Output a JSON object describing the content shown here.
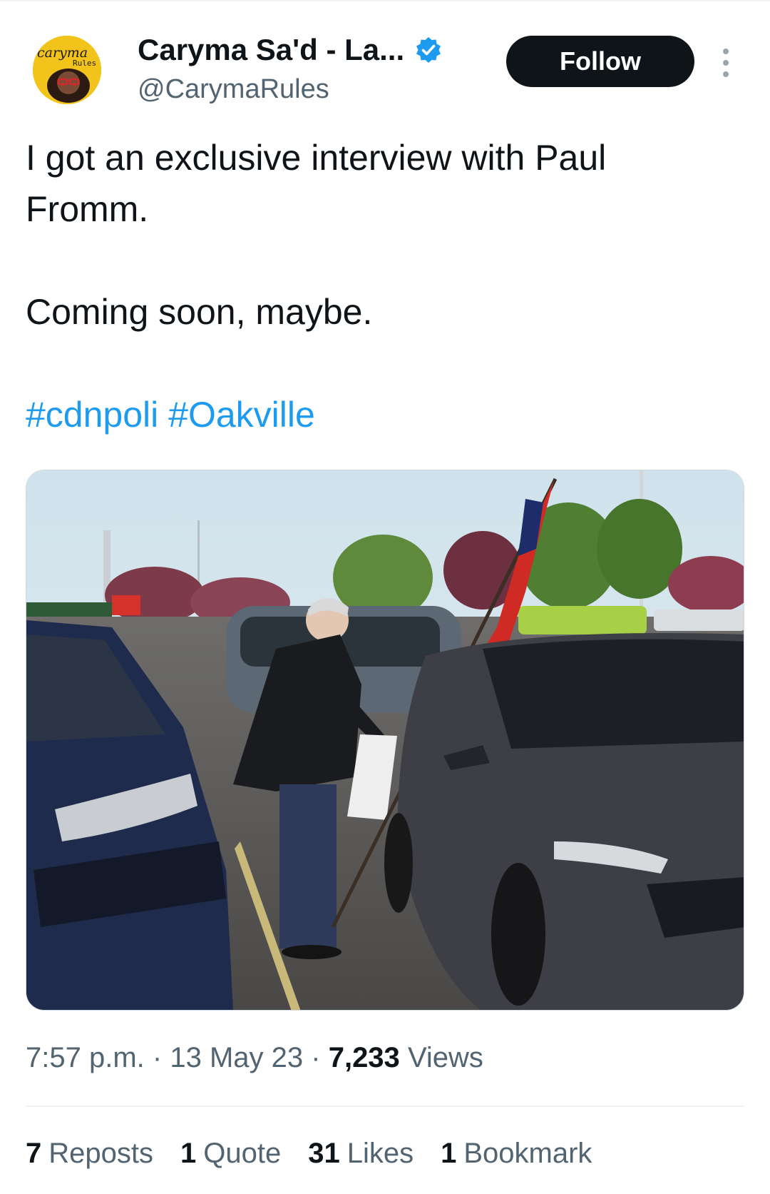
{
  "author": {
    "display_name": "Caryma Sa'd - La...",
    "handle": "@CarymaRules",
    "avatar_text": "caryma",
    "avatar_subtext": "Rules"
  },
  "follow_label": "Follow",
  "tweet": {
    "line1": "I got an exclusive interview with Paul Fromm.",
    "line2": "Coming soon, maybe.",
    "hashtags": [
      "#cdnpoli",
      "#Oakville"
    ]
  },
  "meta": {
    "time": "7:57 p.m.",
    "separator": "·",
    "date": "13 May 23",
    "views_count": "7,233",
    "views_label": "Views"
  },
  "stats": {
    "reposts_count": "7",
    "reposts_label": "Reposts",
    "quotes_count": "1",
    "quotes_label": "Quote",
    "likes_count": "31",
    "likes_label": "Likes",
    "bookmarks_count": "1",
    "bookmarks_label": "Bookmark"
  },
  "colors": {
    "link": "#1d9bf0",
    "verified": "#1d9bf0",
    "text_primary": "#0f1419",
    "text_secondary": "#536471"
  },
  "icons": [
    "verified-badge-icon",
    "more-options-icon"
  ]
}
